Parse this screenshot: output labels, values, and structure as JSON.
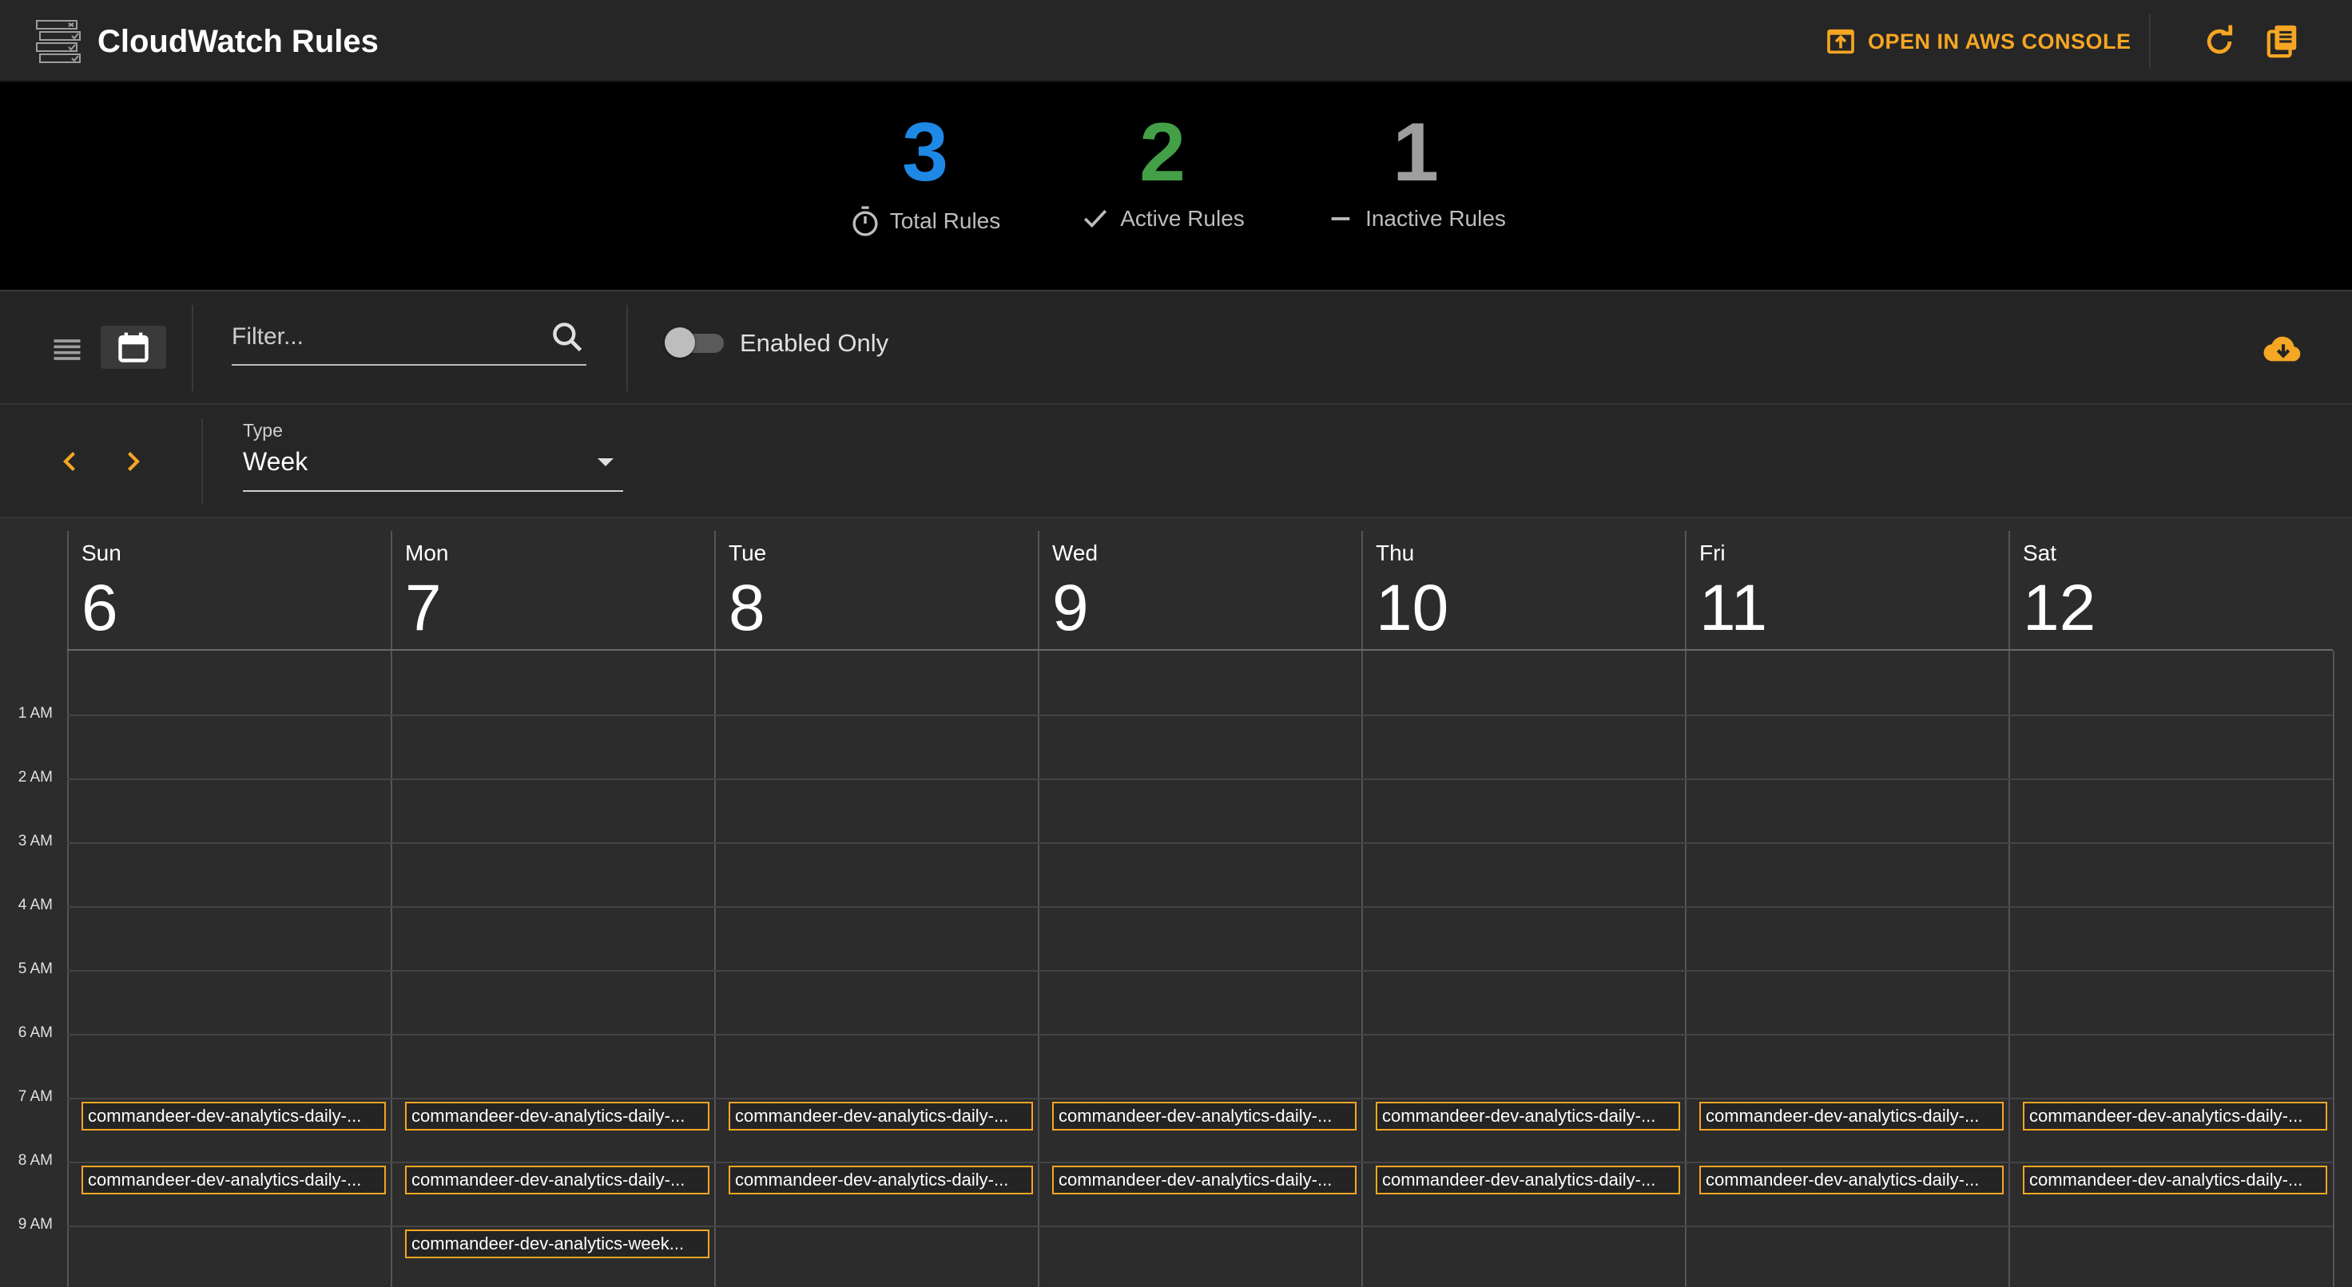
{
  "header": {
    "title": "CloudWatch Rules",
    "console_label": "OPEN IN AWS CONSOLE"
  },
  "stats": [
    {
      "value": "3",
      "label": "Total Rules",
      "color": "#1e88e5"
    },
    {
      "value": "2",
      "label": "Active Rules",
      "color": "#43a047"
    },
    {
      "value": "1",
      "label": "Inactive Rules",
      "color": "#9e9e9e"
    }
  ],
  "toolbar": {
    "filter_placeholder": "Filter...",
    "enabled_only_label": "Enabled Only",
    "enabled_only": false
  },
  "nav": {
    "type_label": "Type",
    "type_value": "Week"
  },
  "calendar": {
    "days": [
      {
        "weekday": "Sun",
        "date": "6"
      },
      {
        "weekday": "Mon",
        "date": "7"
      },
      {
        "weekday": "Tue",
        "date": "8"
      },
      {
        "weekday": "Wed",
        "date": "9"
      },
      {
        "weekday": "Thu",
        "date": "10"
      },
      {
        "weekday": "Fri",
        "date": "11"
      },
      {
        "weekday": "Sat",
        "date": "12"
      }
    ],
    "hours": [
      "1 AM",
      "2 AM",
      "3 AM",
      "4 AM",
      "5 AM",
      "6 AM",
      "7 AM",
      "8 AM",
      "9 AM"
    ],
    "events": [
      {
        "day": 0,
        "hour": 7,
        "label": "commandeer-dev-analytics-daily-..."
      },
      {
        "day": 1,
        "hour": 7,
        "label": "commandeer-dev-analytics-daily-..."
      },
      {
        "day": 2,
        "hour": 7,
        "label": "commandeer-dev-analytics-daily-..."
      },
      {
        "day": 3,
        "hour": 7,
        "label": "commandeer-dev-analytics-daily-..."
      },
      {
        "day": 4,
        "hour": 7,
        "label": "commandeer-dev-analytics-daily-..."
      },
      {
        "day": 5,
        "hour": 7,
        "label": "commandeer-dev-analytics-daily-..."
      },
      {
        "day": 6,
        "hour": 7,
        "label": "commandeer-dev-analytics-daily-..."
      },
      {
        "day": 0,
        "hour": 8,
        "label": "commandeer-dev-analytics-daily-..."
      },
      {
        "day": 1,
        "hour": 8,
        "label": "commandeer-dev-analytics-daily-..."
      },
      {
        "day": 2,
        "hour": 8,
        "label": "commandeer-dev-analytics-daily-..."
      },
      {
        "day": 3,
        "hour": 8,
        "label": "commandeer-dev-analytics-daily-..."
      },
      {
        "day": 4,
        "hour": 8,
        "label": "commandeer-dev-analytics-daily-..."
      },
      {
        "day": 5,
        "hour": 8,
        "label": "commandeer-dev-analytics-daily-..."
      },
      {
        "day": 6,
        "hour": 8,
        "label": "commandeer-dev-analytics-daily-..."
      },
      {
        "day": 1,
        "hour": 9,
        "label": "commandeer-dev-analytics-week..."
      }
    ]
  },
  "colors": {
    "accent": "#f5a623"
  }
}
